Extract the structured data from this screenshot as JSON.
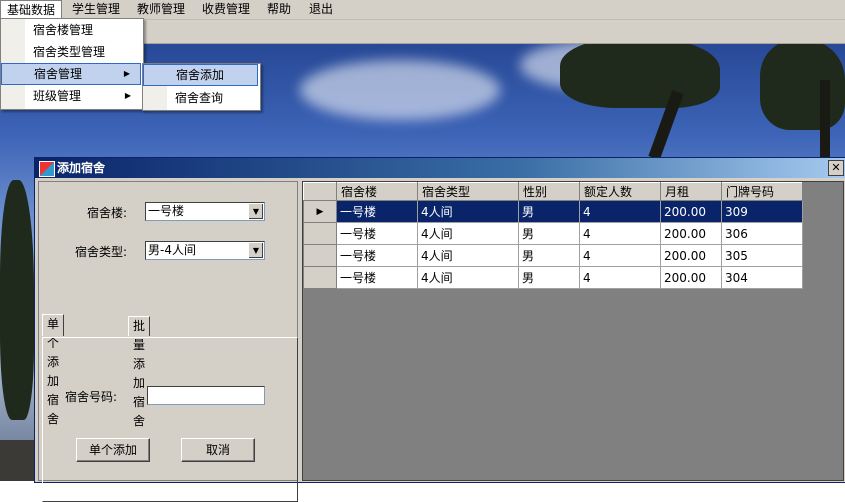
{
  "menubar": {
    "items": [
      "基础数据",
      "学生管理",
      "教师管理",
      "收费管理",
      "帮助",
      "退出"
    ]
  },
  "menu_basic": {
    "items": [
      {
        "label": "宿舍楼管理"
      },
      {
        "label": "宿舍类型管理"
      },
      {
        "label": "宿舍管理",
        "has_submenu": true
      },
      {
        "label": "班级管理",
        "has_submenu": true
      }
    ]
  },
  "submenu_dorm": {
    "items": [
      "宿舍添加",
      "宿舍查询"
    ]
  },
  "window": {
    "title": "添加宿舍",
    "close_glyph": "✕"
  },
  "form": {
    "building_label": "宿舍楼:",
    "building_value": "一号楼",
    "type_label": "宿舍类型:",
    "type_value": "男-4人间",
    "tabs": [
      "单个添加宿舍",
      "批量添加宿舍"
    ],
    "number_label": "宿舍号码:",
    "number_value": "",
    "add_button": "单个添加",
    "cancel_button": "取消"
  },
  "grid": {
    "columns": [
      "宿舍楼",
      "宿舍类型",
      "性别",
      "额定人数",
      "月租",
      "门牌号码"
    ],
    "rows": [
      [
        "一号楼",
        "4人间",
        "男",
        "4",
        "200.00",
        "309"
      ],
      [
        "一号楼",
        "4人间",
        "男",
        "4",
        "200.00",
        "306"
      ],
      [
        "一号楼",
        "4人间",
        "男",
        "4",
        "200.00",
        "305"
      ],
      [
        "一号楼",
        "4人间",
        "男",
        "4",
        "200.00",
        "304"
      ]
    ],
    "selected_row": 0,
    "current_row_glyph": "▶"
  },
  "icons": {
    "combo_arrow": "▼",
    "submenu_arrow": "▶"
  },
  "colors": {
    "selection": "#0a246a",
    "menu_highlight": "#c1d2ee",
    "chrome": "#d4d0c8"
  }
}
